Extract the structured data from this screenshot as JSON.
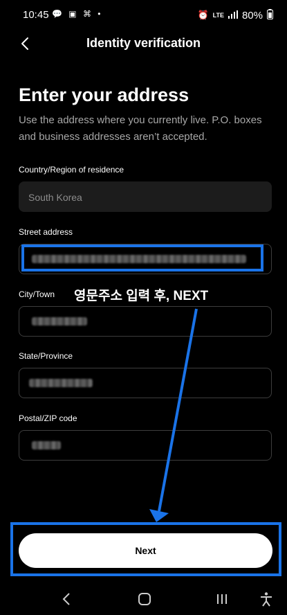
{
  "status_bar": {
    "time": "10:45",
    "left_icons": "💬 ▣ ⌘ •",
    "network": "LTE",
    "battery": "80%"
  },
  "header": {
    "title": "Identity verification"
  },
  "page": {
    "title": "Enter your address",
    "description": "Use the address where you currently live. P.O. boxes and business addresses aren’t accepted."
  },
  "form": {
    "country_label": "Country/Region of residence",
    "country_value": "South Korea",
    "street_label": "Street address",
    "city_label": "City/Town",
    "state_label": "State/Province",
    "postal_label": "Postal/ZIP code"
  },
  "annotation": {
    "text": "영문주소 입력 후, NEXT",
    "color": "#1a73e8"
  },
  "actions": {
    "next_label": "Next"
  }
}
